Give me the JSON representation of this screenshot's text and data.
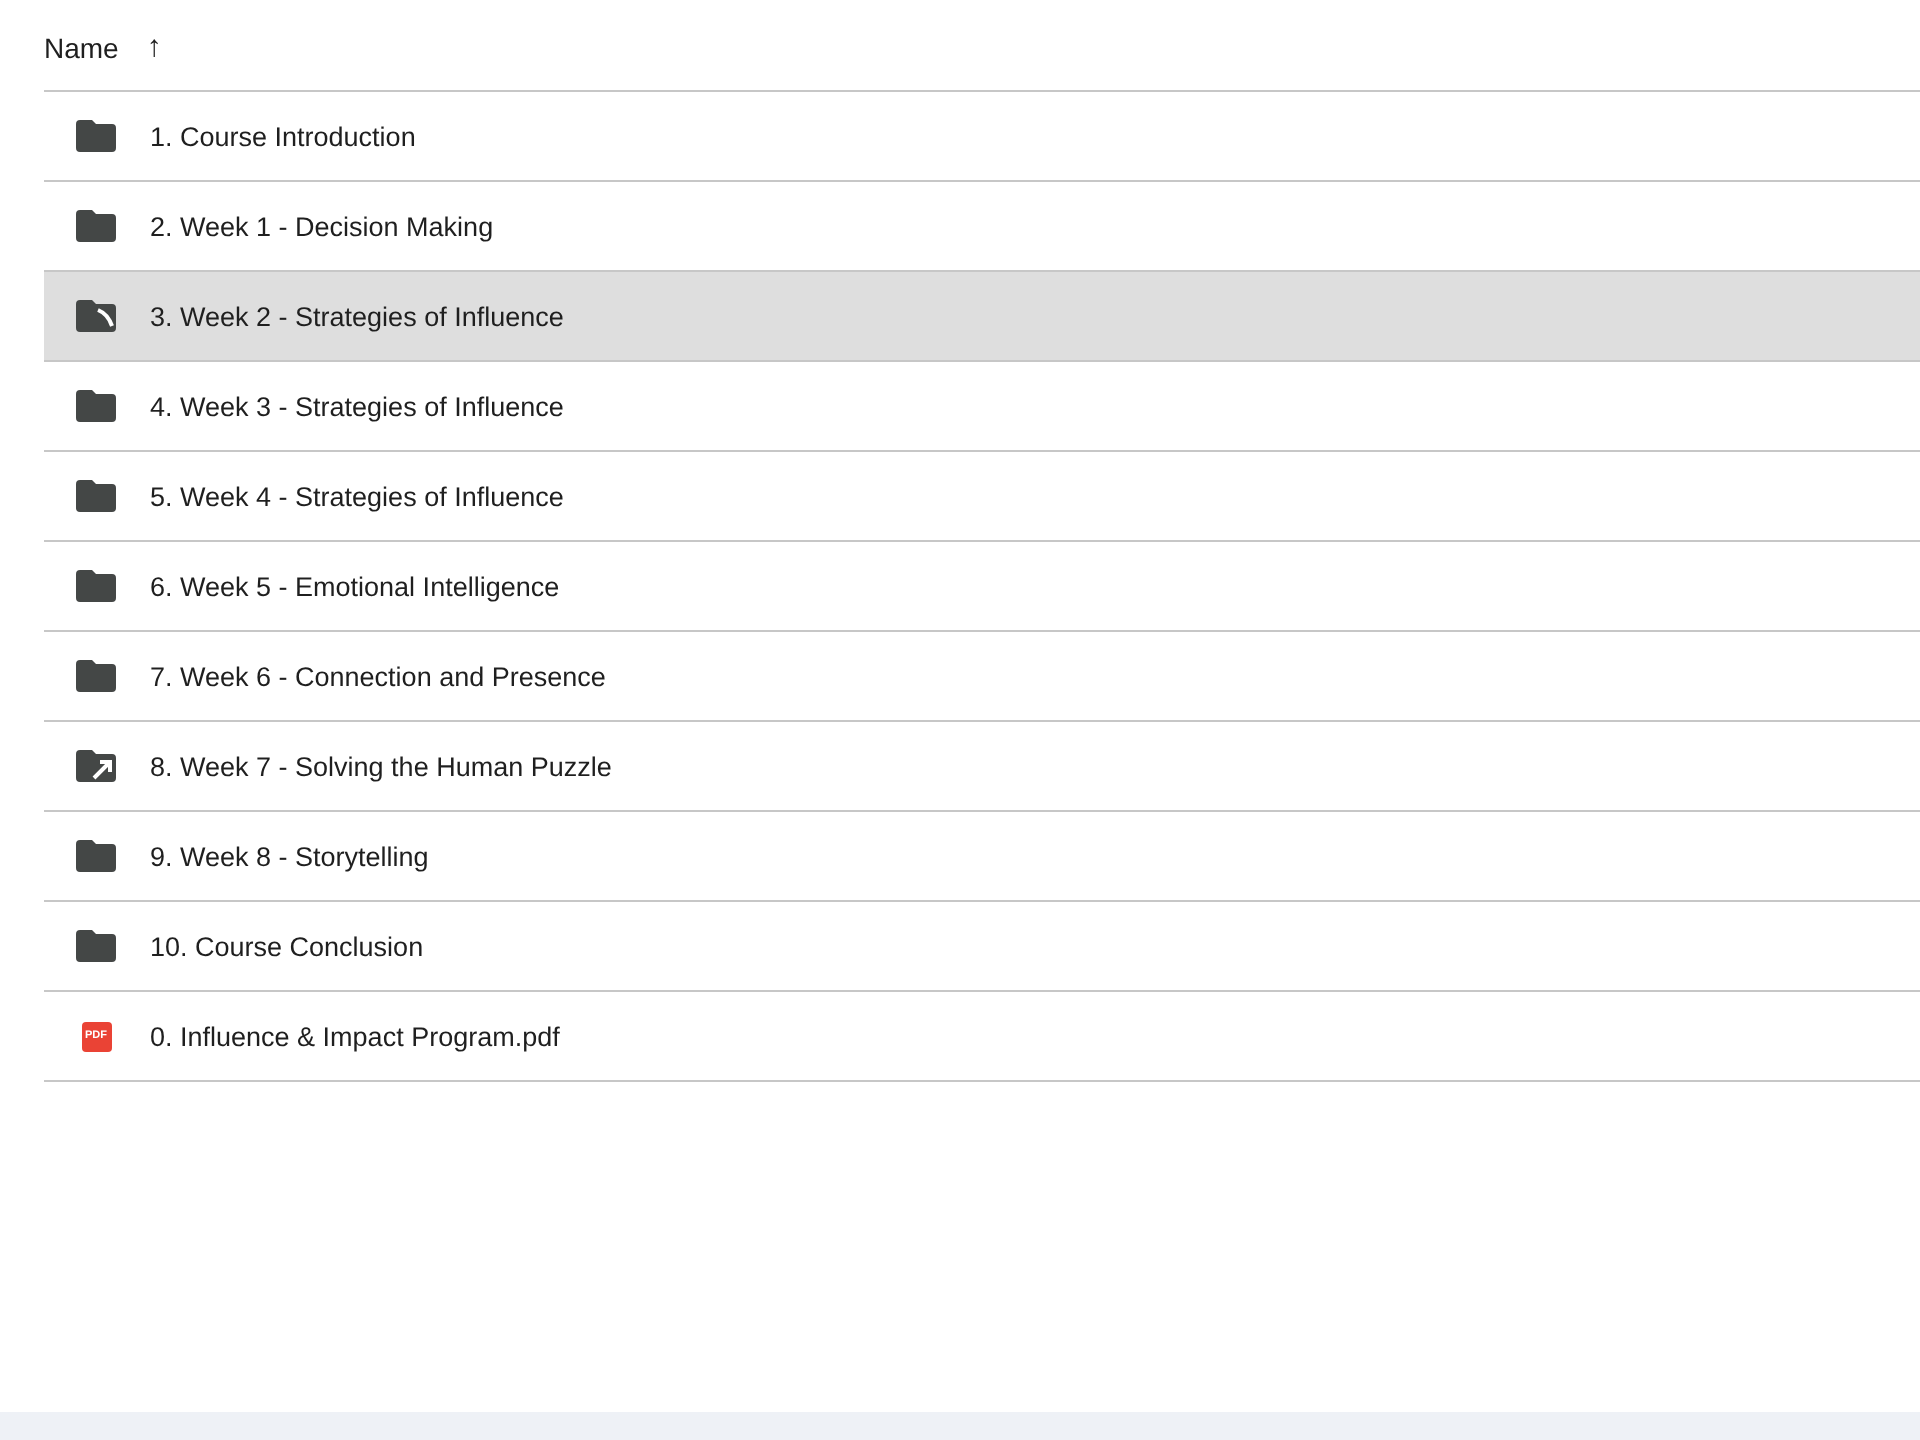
{
  "header": {
    "column": "Name",
    "sort_arrow": "↑"
  },
  "rows": [
    {
      "name": "1. Course Introduction",
      "kind": "folder",
      "highlighted": false
    },
    {
      "name": "2. Week 1 - Decision Making",
      "kind": "folder",
      "highlighted": false
    },
    {
      "name": "3. Week 2 - Strategies of Influence",
      "kind": "folder-variant",
      "highlighted": true
    },
    {
      "name": "4. Week 3 - Strategies of Influence",
      "kind": "folder",
      "highlighted": false
    },
    {
      "name": "5. Week 4 - Strategies of Influence",
      "kind": "folder",
      "highlighted": false
    },
    {
      "name": "6. Week 5 - Emotional Intelligence",
      "kind": "folder",
      "highlighted": false
    },
    {
      "name": "7. Week 6 - Connection and Presence",
      "kind": "folder",
      "highlighted": false
    },
    {
      "name": "8. Week 7 - Solving the Human Puzzle",
      "kind": "folder-arrow",
      "highlighted": false
    },
    {
      "name": "9. Week 8 - Storytelling",
      "kind": "folder",
      "highlighted": false
    },
    {
      "name": "10. Course Conclusion",
      "kind": "folder",
      "highlighted": false
    },
    {
      "name": "0. Influence & Impact Program.pdf",
      "kind": "pdf",
      "badge": "PDF",
      "highlighted": false
    }
  ]
}
